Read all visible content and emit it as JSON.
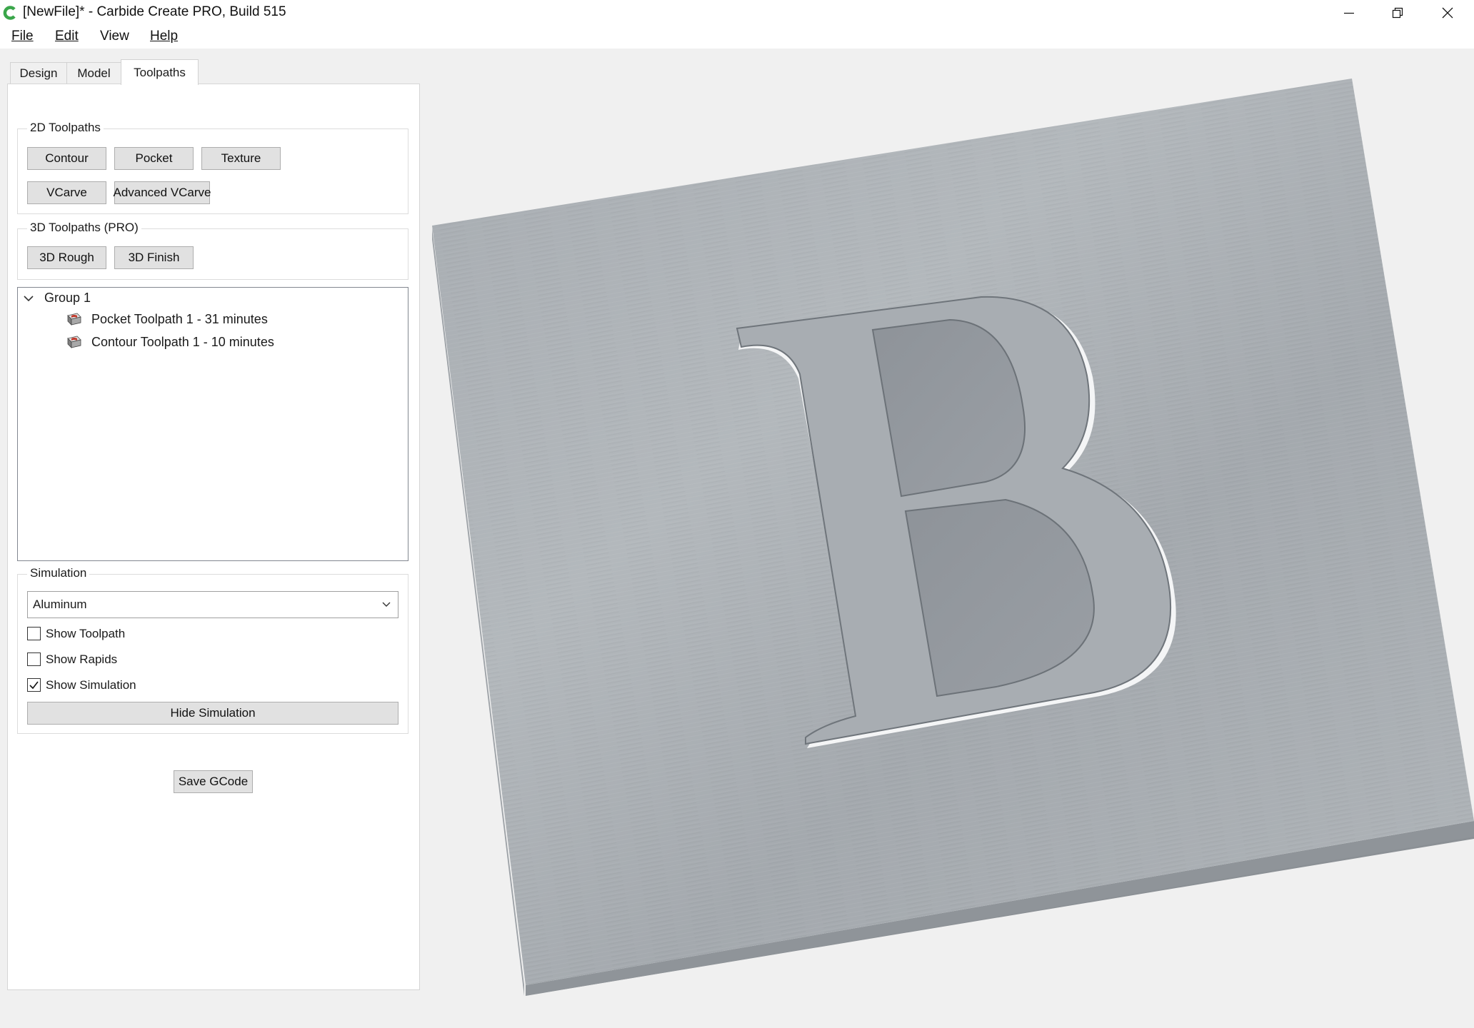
{
  "window": {
    "title": "[NewFile]* - Carbide Create PRO, Build 515",
    "brand_color": "#3aa64a"
  },
  "menu": {
    "file": "File",
    "edit": "Edit",
    "view": "View",
    "help": "Help"
  },
  "tabs": {
    "design": "Design",
    "model": "Model",
    "toolpaths": "Toolpaths",
    "active": "Toolpaths"
  },
  "toolpaths_2d": {
    "title": "2D Toolpaths",
    "contour": "Contour",
    "pocket": "Pocket",
    "texture": "Texture",
    "vcarve": "VCarve",
    "advanced_vcarve": "Advanced VCarve"
  },
  "toolpaths_3d": {
    "title": "3D Toolpaths (PRO)",
    "rough": "3D Rough",
    "finish": "3D Finish"
  },
  "tree": {
    "group": "Group 1",
    "items": [
      {
        "label": "Pocket Toolpath 1 - 31 minutes",
        "icon": "toolpath-icon"
      },
      {
        "label": "Contour Toolpath 1 - 10 minutes",
        "icon": "toolpath-icon"
      }
    ]
  },
  "simulation": {
    "title": "Simulation",
    "material": "Aluminum",
    "show_toolpath": {
      "label": "Show Toolpath",
      "checked": false
    },
    "show_rapids": {
      "label": "Show Rapids",
      "checked": false
    },
    "show_simulation": {
      "label": "Show Simulation",
      "checked": true
    },
    "hide_button": "Hide Simulation"
  },
  "save_gcode": "Save GCode",
  "viewport": {
    "carved_letter": "B",
    "material_color": "#a9aeb3"
  }
}
